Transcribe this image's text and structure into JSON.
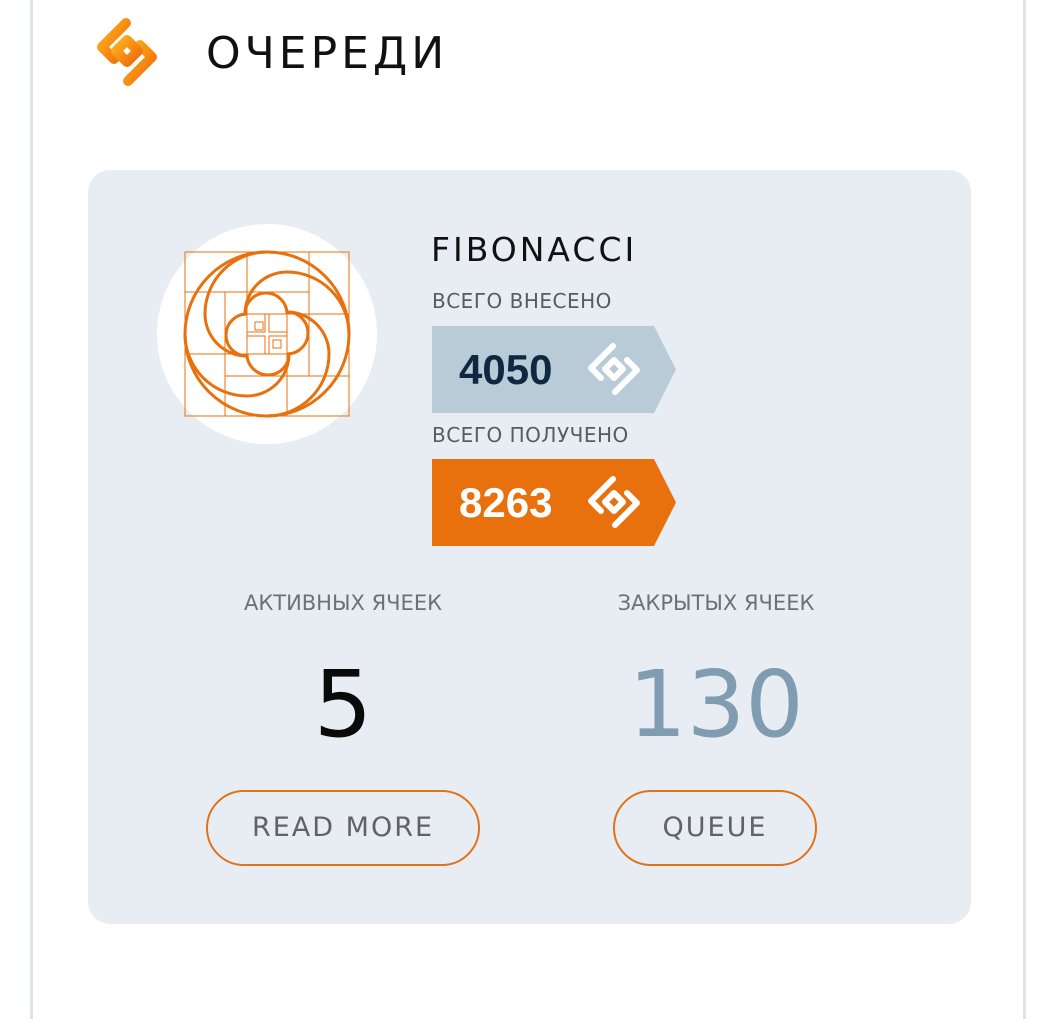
{
  "header": {
    "title": "ОЧЕРЕДИ",
    "logo_icon": "orange-diamond-link-logo"
  },
  "queue": {
    "name": "FIBONACCI",
    "avatar_icon": "fibonacci-spiral-icon",
    "contributed": {
      "label": "ВСЕГО ВНЕСЕНО",
      "value": "4050",
      "icon": "diamond-link-token-icon",
      "color": "#b9cbd7"
    },
    "received": {
      "label": "ВСЕГО ПОЛУЧЕНО",
      "value": "8263",
      "icon": "diamond-link-token-icon",
      "color": "#e8710d"
    },
    "active_cells": {
      "label": "АКТИВНЫХ ЯЧЕЕК",
      "value": "5"
    },
    "closed_cells": {
      "label": "ЗАКРЫТЫХ ЯЧЕЕК",
      "value": "130"
    },
    "buttons": {
      "read_more": "READ MORE",
      "queue": "QUEUE"
    }
  },
  "colors": {
    "accent": "#e8710d",
    "card_background": "#e8edf3",
    "muted_number": "#7f9cb1"
  }
}
